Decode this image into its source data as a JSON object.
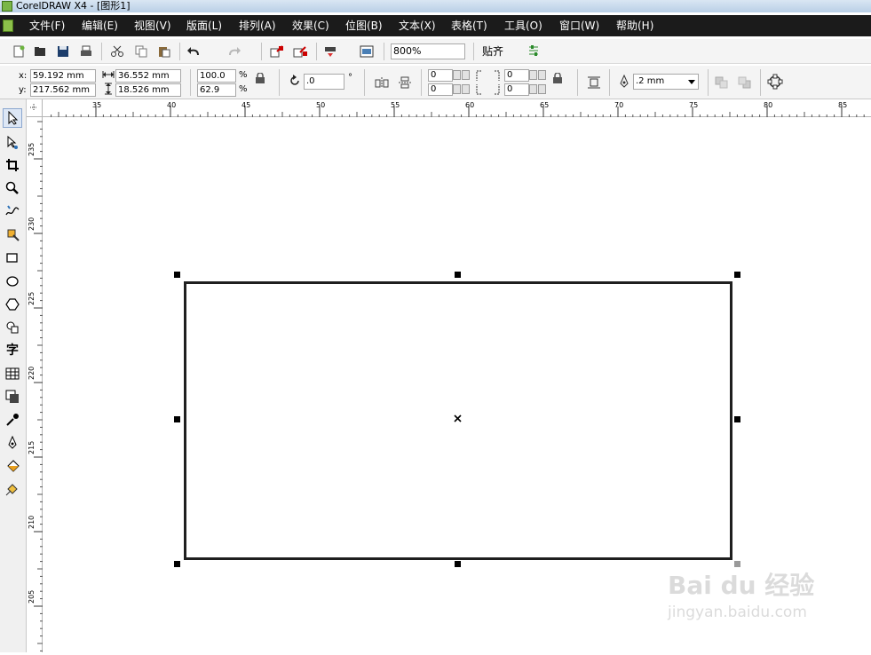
{
  "window": {
    "title": "CorelDRAW X4 - [图形1]"
  },
  "menu": {
    "items": [
      "文件(F)",
      "编辑(E)",
      "视图(V)",
      "版面(L)",
      "排列(A)",
      "效果(C)",
      "位图(B)",
      "文本(X)",
      "表格(T)",
      "工具(O)",
      "窗口(W)",
      "帮助(H)"
    ]
  },
  "toolbar": {
    "zoom_value": "800%",
    "snap_label": "贴齐"
  },
  "property_bar": {
    "x_label": "x:",
    "x_value": "59.192 mm",
    "y_label": "y:",
    "y_value": "217.562 mm",
    "width_value": "36.552 mm",
    "height_value": "18.526 mm",
    "scale_x": "100.0",
    "scale_y": "62.9",
    "percent": "%",
    "rotation": ".0",
    "degree": "°",
    "corner_tl": "0",
    "corner_bl": "0",
    "corner_tr": "0",
    "corner_br": "0",
    "outline_width": ".2 mm"
  },
  "ruler_top": {
    "labels": [
      "35",
      "40",
      "45",
      "50",
      "55",
      "60",
      "65",
      "70",
      "75",
      "80",
      "85"
    ]
  },
  "ruler_left": {
    "labels": [
      "235",
      "230",
      "225",
      "220",
      "215",
      "210",
      "205"
    ]
  },
  "toolbox": {
    "tools": [
      "pick-tool",
      "shape-tool",
      "crop-tool",
      "zoom-tool",
      "freehand-tool",
      "smart-fill-tool",
      "rectangle-tool",
      "ellipse-tool",
      "polygon-tool",
      "basic-shapes-tool",
      "text-tool",
      "table-tool",
      "interactive-tool",
      "eyedropper-tool",
      "outline-tool",
      "fill-tool",
      "interactive-fill-tool"
    ],
    "text_tool_glyph": "字"
  },
  "watermark": {
    "main": "Bai du 经验",
    "sub": "jingyan.baidu.com"
  }
}
